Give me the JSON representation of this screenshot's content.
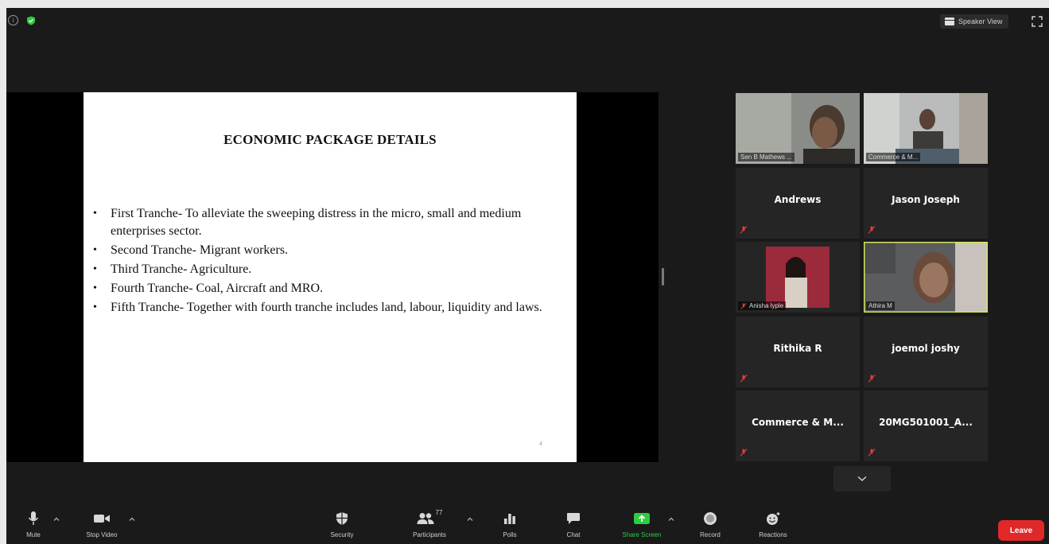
{
  "topbar": {
    "speaker_view_label": "Speaker View"
  },
  "slide": {
    "title": "ECONOMIC PACKAGE DETAILS",
    "bullets": [
      "First Tranche- To alleviate the sweeping distress in the micro, small and medium enterprises sector.",
      "Second Tranche- Migrant workers.",
      "Third Tranche- Agriculture.",
      "Fourth Tranche- Coal, Aircraft and MRO.",
      "Fifth Tranche- Together with fourth tranche includes land, labour, liquidity and laws."
    ],
    "page_number": "4"
  },
  "gallery": {
    "tiles": [
      {
        "name": "Sen B Mathews ...",
        "type": "video"
      },
      {
        "name": "Commerce & M...",
        "type": "video"
      },
      {
        "name": "Andrews",
        "type": "name"
      },
      {
        "name": "Jason Joseph",
        "type": "name"
      },
      {
        "name": "Anisha lyple",
        "type": "video"
      },
      {
        "name": "Athira M",
        "type": "video",
        "active": true
      },
      {
        "name": "Rithika R",
        "type": "name"
      },
      {
        "name": "joemol joshy",
        "type": "name"
      },
      {
        "name": "Commerce & M...",
        "type": "name"
      },
      {
        "name": "20MG501001_A...",
        "type": "name"
      }
    ]
  },
  "toolbar": {
    "mute": "Mute",
    "stop_video": "Stop Video",
    "security": "Security",
    "participants": "Participants",
    "participants_count": "77",
    "polls": "Polls",
    "chat": "Chat",
    "share_screen": "Share Screen",
    "record": "Record",
    "reactions": "Reactions",
    "leave": "Leave"
  },
  "colors": {
    "active_speaker": "#d5e55a",
    "leave": "#e02828",
    "share_green": "#2ecc40",
    "muted_red": "#e23b3b"
  }
}
